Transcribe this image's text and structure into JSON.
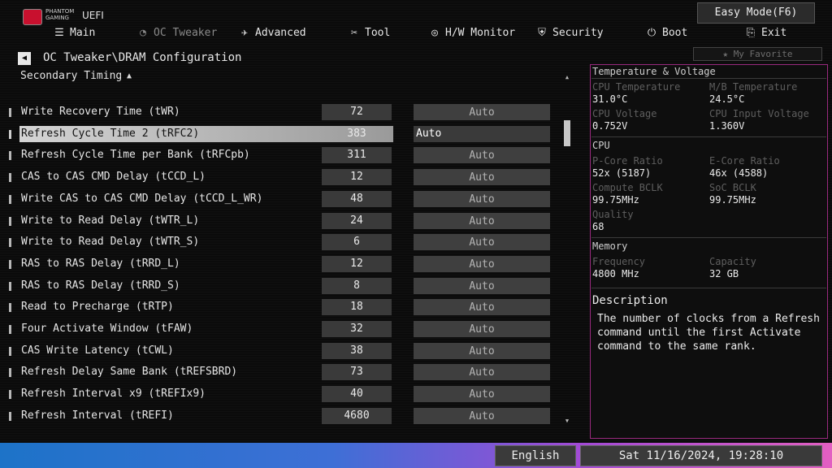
{
  "header": {
    "brand_line1": "PHANTOM",
    "brand_line2": "GAMING",
    "uefi": "UEFI",
    "easy_mode": "Easy Mode(F6)",
    "nav": [
      {
        "label": "Main",
        "icon": "menu-icon"
      },
      {
        "label": "OC Tweaker",
        "icon": "oc-tweaker-icon",
        "active": true
      },
      {
        "label": "Advanced",
        "icon": "advanced-icon"
      },
      {
        "label": "Tool",
        "icon": "tool-icon"
      },
      {
        "label": "H/W Monitor",
        "icon": "hw-monitor-icon"
      },
      {
        "label": "Security",
        "icon": "shield-icon"
      },
      {
        "label": "Boot",
        "icon": "power-icon"
      },
      {
        "label": "Exit",
        "icon": "exit-icon"
      }
    ]
  },
  "breadcrumb": "OC Tweaker\\DRAM Configuration",
  "favorite": "My Favorite",
  "section": "Secondary Timing",
  "settings": [
    {
      "label": "Write Recovery Time (tWR)",
      "value": "72",
      "option": "Auto"
    },
    {
      "label": "Refresh Cycle Time 2 (tRFC2)",
      "value": "383",
      "option": "Auto",
      "selected": true
    },
    {
      "label": "Refresh Cycle Time per Bank (tRFCpb)",
      "value": "311",
      "option": "Auto"
    },
    {
      "label": "CAS to CAS CMD Delay (tCCD_L)",
      "value": "12",
      "option": "Auto"
    },
    {
      "label": "Write CAS to CAS CMD Delay (tCCD_L_WR)",
      "value": "48",
      "option": "Auto"
    },
    {
      "label": "Write to Read Delay (tWTR_L)",
      "value": "24",
      "option": "Auto"
    },
    {
      "label": "Write to Read Delay (tWTR_S)",
      "value": "6",
      "option": "Auto"
    },
    {
      "label": "RAS to RAS Delay (tRRD_L)",
      "value": "12",
      "option": "Auto"
    },
    {
      "label": "RAS to RAS Delay (tRRD_S)",
      "value": "8",
      "option": "Auto"
    },
    {
      "label": "Read to Precharge (tRTP)",
      "value": "18",
      "option": "Auto"
    },
    {
      "label": "Four Activate Window (tFAW)",
      "value": "32",
      "option": "Auto"
    },
    {
      "label": "CAS Write Latency (tCWL)",
      "value": "38",
      "option": "Auto"
    },
    {
      "label": "Refresh Delay Same Bank (tREFSBRD)",
      "value": "73",
      "option": "Auto"
    },
    {
      "label": "Refresh Interval x9 (tREFIx9)",
      "value": "40",
      "option": "Auto"
    },
    {
      "label": "Refresh Interval (tREFI)",
      "value": "4680",
      "option": "Auto"
    }
  ],
  "panel": {
    "temp_voltage_title": "Temperature & Voltage",
    "cpu_temp_label": "CPU Temperature",
    "cpu_temp": "31.0°C",
    "mb_temp_label": "M/B Temperature",
    "mb_temp": "24.5°C",
    "cpu_voltage_label": "CPU Voltage",
    "cpu_voltage": "0.752V",
    "cpu_input_voltage_label": "CPU Input Voltage",
    "cpu_input_voltage": "1.360V",
    "cpu_title": "CPU",
    "pcore_label": "P-Core Ratio",
    "pcore": "52x (5187)",
    "ecore_label": "E-Core Ratio",
    "ecore": "46x (4588)",
    "compute_bclk_label": "Compute BCLK",
    "compute_bclk": "99.75MHz",
    "soc_bclk_label": "SoC BCLK",
    "soc_bclk": "99.75MHz",
    "quality_label": "Quality",
    "quality": "68",
    "memory_title": "Memory",
    "frequency_label": "Frequency",
    "frequency": "4800 MHz",
    "capacity_label": "Capacity",
    "capacity": "32 GB",
    "description_title": "Description",
    "description": "The number of clocks from a Refresh command until the first Activate command to the same rank."
  },
  "footer": {
    "language": "English",
    "datetime": "Sat 11/16/2024, 19:28:10"
  },
  "colors": {
    "panel_border": "#9a2a7f",
    "footer_gradient_start": "#1d73c8",
    "footer_gradient_end": "#e25fc2"
  }
}
